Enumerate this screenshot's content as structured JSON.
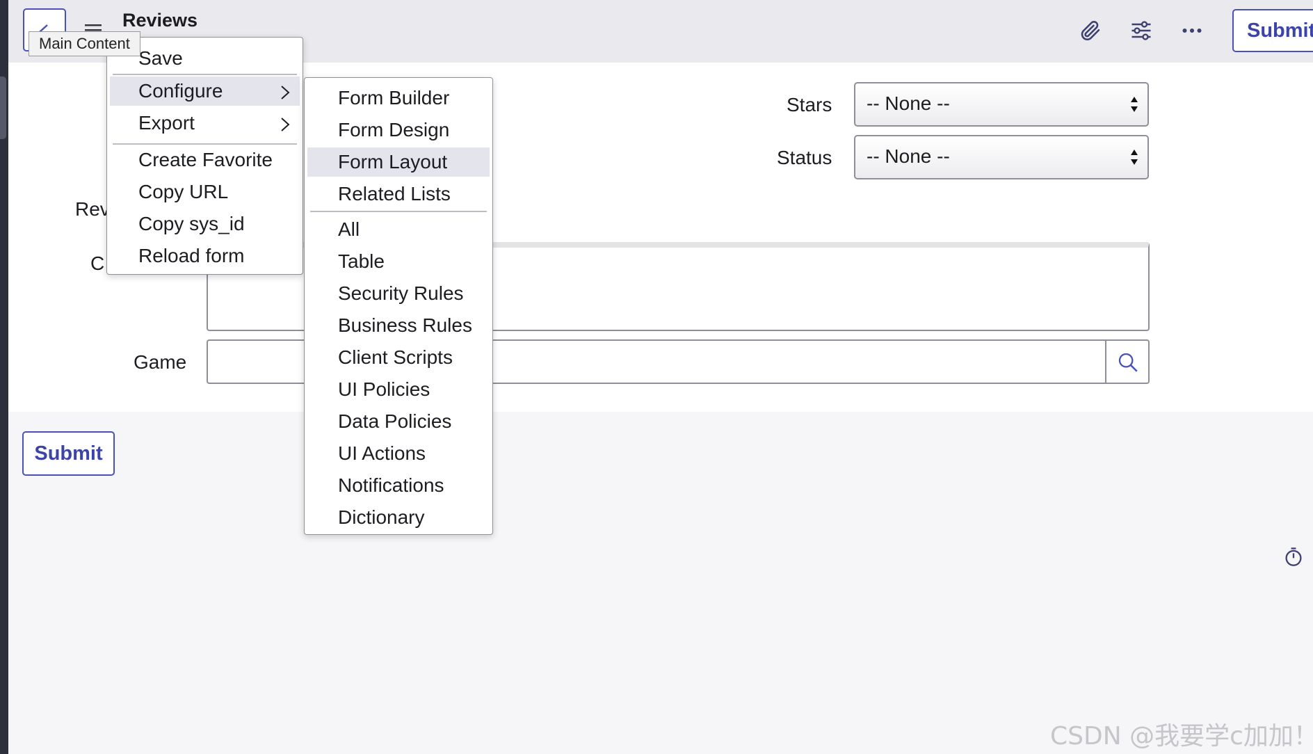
{
  "header": {
    "title": "Reviews",
    "tooltip": "Main Content",
    "submit_label": "Submit",
    "icons": [
      "back-chevron-icon",
      "hamburger-icon",
      "paperclip-icon",
      "sliders-icon",
      "more-icon"
    ]
  },
  "context_menu": {
    "items": [
      {
        "label": "Save"
      },
      {
        "label": "Configure"
      },
      {
        "label": "Export"
      },
      {
        "label": "Create Favorite"
      },
      {
        "label": "Copy URL"
      },
      {
        "label": "Copy sys_id"
      },
      {
        "label": "Reload form"
      }
    ]
  },
  "configure_submenu": {
    "items": [
      {
        "label": "Form Builder"
      },
      {
        "label": "Form Design"
      },
      {
        "label": "Form Layout"
      },
      {
        "label": "Related Lists"
      },
      {
        "label": "All"
      },
      {
        "label": "Table"
      },
      {
        "label": "Security Rules"
      },
      {
        "label": "Business Rules"
      },
      {
        "label": "Client Scripts"
      },
      {
        "label": "UI Policies"
      },
      {
        "label": "Data Policies"
      },
      {
        "label": "UI Actions"
      },
      {
        "label": "Notifications"
      },
      {
        "label": "Dictionary"
      }
    ]
  },
  "form": {
    "review_label_partial": "Rev",
    "comment_label_partial": "C",
    "stars_label": "Stars",
    "stars_value": "-- None --",
    "status_label": "Status",
    "status_value": "-- None --",
    "game_label": "Game",
    "submit_label": "Submit"
  },
  "watermark": "CSDN @我要学c加加！",
  "colors": {
    "accent": "#4951b6",
    "header_bg": "#e9e9ee",
    "menu_highlight": "#e4e4ec"
  }
}
